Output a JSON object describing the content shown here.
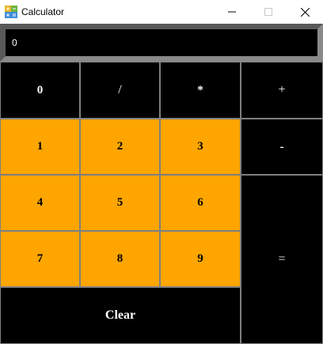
{
  "window": {
    "title": "Calculator",
    "icon": "calculator-app-icon",
    "controls": [
      "minimize-icon",
      "maximize-icon",
      "close-icon"
    ]
  },
  "display": {
    "value": "0"
  },
  "keys": {
    "k0": "0",
    "div": "/",
    "mul": "*",
    "add": "+",
    "k1": "1",
    "k2": "2",
    "k3": "3",
    "sub": "-",
    "k4": "4",
    "k5": "5",
    "k6": "6",
    "k7": "7",
    "k8": "8",
    "k9": "9",
    "eq": "=",
    "clear": "Clear"
  },
  "colors": {
    "number_key_bg": "#ffa500",
    "operator_key_bg": "#000000",
    "display_bg": "#000000",
    "display_border": "#595959"
  }
}
